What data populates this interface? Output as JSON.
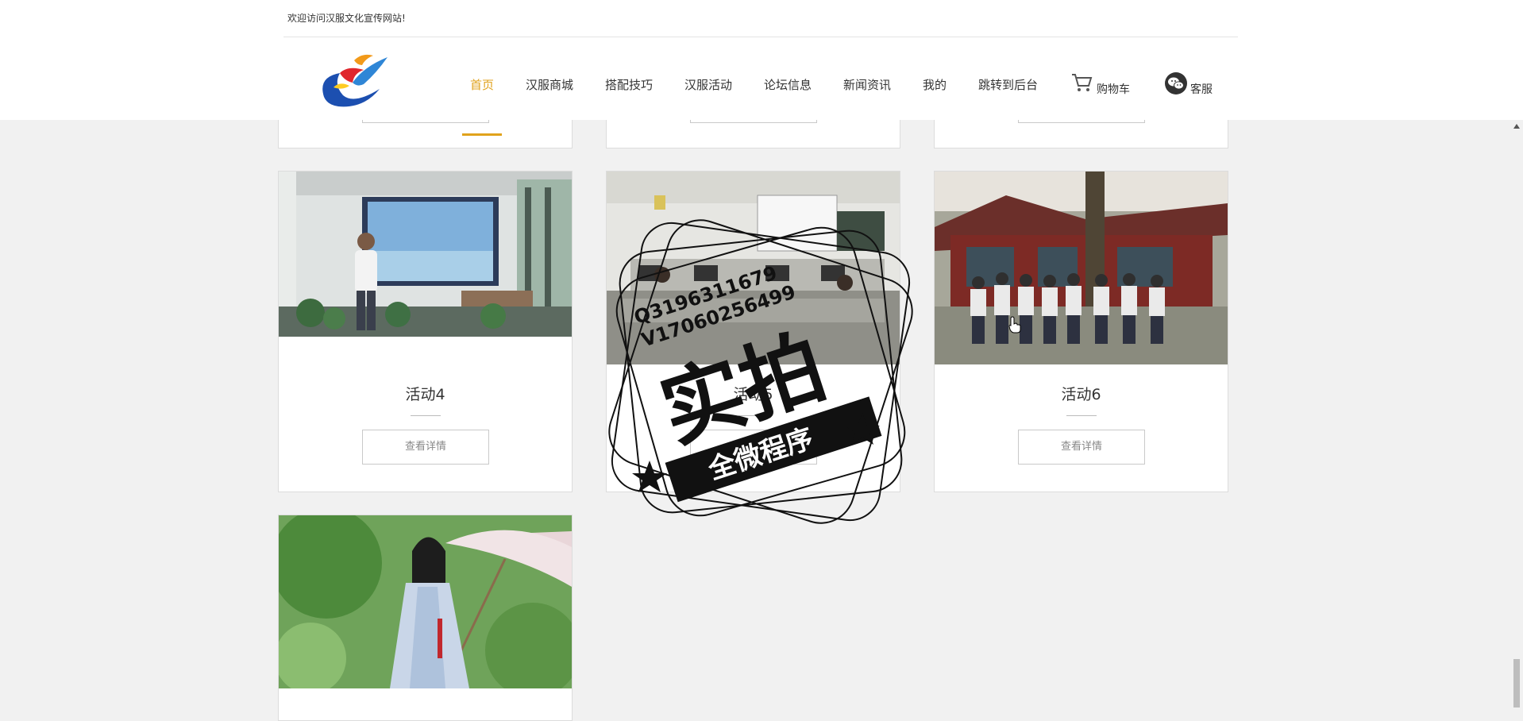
{
  "header": {
    "welcome": "欢迎访问汉服文化宣传网站!",
    "nav": [
      {
        "label": "首页",
        "active": true
      },
      {
        "label": "汉服商城",
        "active": false
      },
      {
        "label": "搭配技巧",
        "active": false
      },
      {
        "label": "汉服活动",
        "active": false
      },
      {
        "label": "论坛信息",
        "active": false
      },
      {
        "label": "新闻资讯",
        "active": false
      },
      {
        "label": "我的",
        "active": false
      },
      {
        "label": "跳转到后台",
        "active": false
      }
    ],
    "cart_label": "购物车",
    "service_label": "客服",
    "accent_color": "#e0a21c"
  },
  "cards": [
    {
      "title": "活动4",
      "button": "查看详情",
      "image": "person-in-front-of-presentation-screen"
    },
    {
      "title": "活动5",
      "button": "查看详情",
      "image": "computer-classroom"
    },
    {
      "title": "活动6",
      "button": "查看详情",
      "image": "group-in-front-of-temple"
    },
    {
      "title": "",
      "button": "",
      "image": "woman-in-hanfu-with-parasol"
    }
  ],
  "watermark": {
    "main": "实拍",
    "banner": "全微程序",
    "line1": "Q3196311679",
    "line2": "V17060256499"
  }
}
